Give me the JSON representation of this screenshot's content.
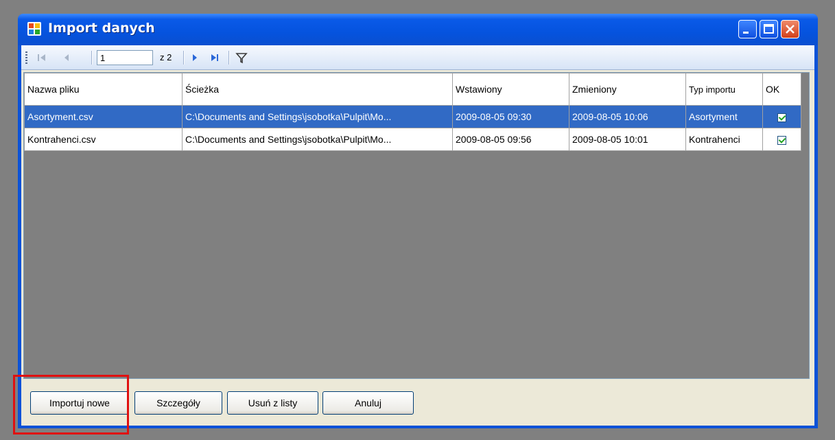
{
  "window": {
    "title": "Import danych",
    "accent": "#0a52d8"
  },
  "toolbar": {
    "first_icon": "move-first-icon",
    "prev_icon": "move-previous-icon",
    "position_value": "1",
    "of_label": "z 2",
    "next_icon": "move-next-icon",
    "last_icon": "move-last-icon",
    "filter_icon": "filter-icon"
  },
  "grid": {
    "columns": [
      "Nazwa pliku",
      "Ścieżka",
      "Wstawiony",
      "Zmieniony",
      "Typ importu",
      "OK"
    ],
    "rows": [
      {
        "name": "Asortyment.csv",
        "path": "C:\\Documents and Settings\\jsobotka\\Pulpit\\Mo...",
        "inserted": "2009-08-05 09:30",
        "changed": "2009-08-05 10:06",
        "type": "Asortyment",
        "ok": true,
        "selected": true
      },
      {
        "name": "Kontrahenci.csv",
        "path": "C:\\Documents and Settings\\jsobotka\\Pulpit\\Mo...",
        "inserted": "2009-08-05 09:56",
        "changed": "2009-08-05 10:01",
        "type": "Kontrahenci",
        "ok": true,
        "selected": false
      }
    ],
    "selection_color": "#316ac5"
  },
  "buttons": {
    "import_new": "Importuj nowe",
    "details": "Szczegóły",
    "remove": "Usuń z listy",
    "cancel": "Anuluj"
  },
  "annotation": {
    "color": "#e01010"
  }
}
